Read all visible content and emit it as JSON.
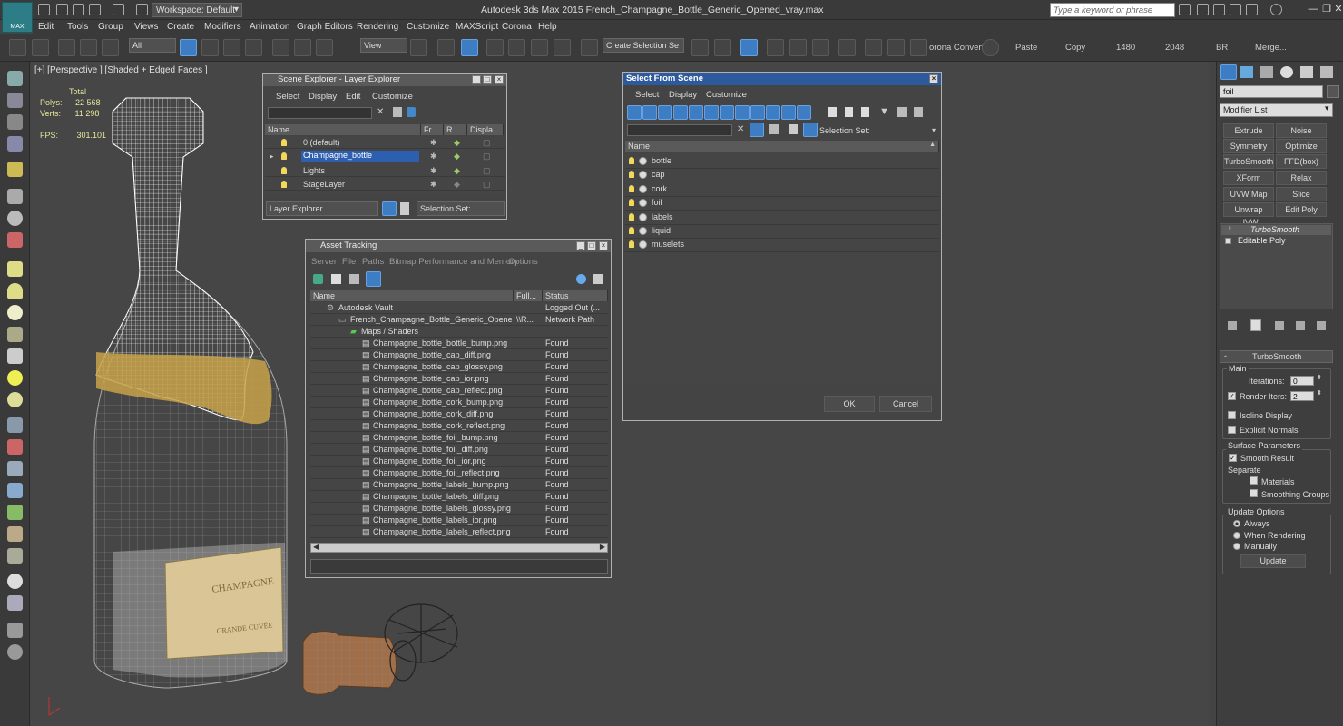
{
  "app": {
    "title": "Autodesk 3ds Max  2015     French_Champagne_Bottle_Generic_Opened_vray.max",
    "logo_label": "MAX",
    "workspace": "Workspace: Default",
    "search_placeholder": "Type a keyword or phrase"
  },
  "menus": [
    "Edit",
    "Tools",
    "Group",
    "Views",
    "Create",
    "Modifiers",
    "Animation",
    "Graph Editors",
    "Rendering",
    "Customize",
    "MAXScript",
    "Corona",
    "Help"
  ],
  "toolbar": {
    "filter": "All",
    "ref_coord": "View",
    "selection_set": "Create Selection Se",
    "corona_convert": "orona Convert",
    "paste": "Paste",
    "copy": "Copy",
    "res1": "1480",
    "res2": "2048",
    "br": "BR",
    "merge": "Merge..."
  },
  "viewport": {
    "label": "[+] [Perspective ] [Shaded + Edged Faces ]",
    "stats_total": "Total",
    "polys_label": "Polys:",
    "polys_value": "22 568",
    "verts_label": "Verts:",
    "verts_value": "11 298",
    "fps_label": "FPS:",
    "fps_value": "301.101"
  },
  "layer_explorer": {
    "title": "Scene Explorer - Layer Explorer",
    "menus": [
      "Select",
      "Display",
      "Edit",
      "Customize"
    ],
    "columns": [
      "Name",
      "Fr...",
      "R...",
      "Displa..."
    ],
    "rows": [
      {
        "name": "0 (default)"
      },
      {
        "name": "Champagne_bottle"
      },
      {
        "name": "Lights"
      },
      {
        "name": "StageLayer"
      }
    ],
    "footer_dropdown": "Layer Explorer",
    "selection_set": "Selection Set:"
  },
  "asset_tracking": {
    "title": "Asset Tracking",
    "menus": [
      "Server",
      "File",
      "Paths",
      "Bitmap Performance and Memory",
      "Options"
    ],
    "columns": [
      "Name",
      "Full...",
      "Status"
    ],
    "vault": {
      "name": "Autodesk Vault",
      "status": "Logged Out (..."
    },
    "file": {
      "name": "French_Champagne_Bottle_Generic_Opened...",
      "full": "\\\\R...",
      "status": "Network Path"
    },
    "maps": "Maps / Shaders",
    "items": [
      {
        "name": "Champagne_bottle_bottle_bump.png",
        "status": "Found"
      },
      {
        "name": "Champagne_bottle_cap_diff.png",
        "status": "Found"
      },
      {
        "name": "Champagne_bottle_cap_glossy.png",
        "status": "Found"
      },
      {
        "name": "Champagne_bottle_cap_ior.png",
        "status": "Found"
      },
      {
        "name": "Champagne_bottle_cap_reflect.png",
        "status": "Found"
      },
      {
        "name": "Champagne_bottle_cork_bump.png",
        "status": "Found"
      },
      {
        "name": "Champagne_bottle_cork_diff.png",
        "status": "Found"
      },
      {
        "name": "Champagne_bottle_cork_reflect.png",
        "status": "Found"
      },
      {
        "name": "Champagne_bottle_foil_bump.png",
        "status": "Found"
      },
      {
        "name": "Champagne_bottle_foil_diff.png",
        "status": "Found"
      },
      {
        "name": "Champagne_bottle_foil_ior.png",
        "status": "Found"
      },
      {
        "name": "Champagne_bottle_foil_reflect.png",
        "status": "Found"
      },
      {
        "name": "Champagne_bottle_labels_bump.png",
        "status": "Found"
      },
      {
        "name": "Champagne_bottle_labels_diff.png",
        "status": "Found"
      },
      {
        "name": "Champagne_bottle_labels_glossy.png",
        "status": "Found"
      },
      {
        "name": "Champagne_bottle_labels_ior.png",
        "status": "Found"
      },
      {
        "name": "Champagne_bottle_labels_reflect.png",
        "status": "Found"
      }
    ]
  },
  "select_from_scene": {
    "title": "Select From Scene",
    "menus": [
      "Select",
      "Display",
      "Customize"
    ],
    "selection_set": "Selection Set:",
    "column": "Name",
    "objects": [
      "bottle",
      "cap",
      "cork",
      "foil",
      "labels",
      "liquid",
      "muselets"
    ],
    "ok": "OK",
    "cancel": "Cancel"
  },
  "command_panel": {
    "name_field": "foil",
    "modifier_list": "Modifier List",
    "buttons": [
      [
        "Extrude",
        "Noise"
      ],
      [
        "Symmetry",
        "Optimize"
      ],
      [
        "TurboSmooth",
        "FFD(box)"
      ],
      [
        "XForm",
        "Relax"
      ],
      [
        "UVW Map",
        "Slice"
      ],
      [
        "Unwrap UVW",
        "Edit Poly"
      ]
    ],
    "stack": [
      "TurboSmooth",
      "Editable Poly"
    ],
    "rollout_title": "TurboSmooth",
    "main_label": "Main",
    "iterations_label": "Iterations:",
    "iterations_value": "0",
    "render_iters_label": "Render Iters:",
    "render_iters_value": "2",
    "isoline": "Isoline Display",
    "explicit": "Explicit Normals",
    "surface_label": "Surface Parameters",
    "smooth_result": "Smooth Result",
    "separate_label": "Separate",
    "materials": "Materials",
    "smoothing_groups": "Smoothing Groups",
    "update_options": "Update Options",
    "always": "Always",
    "when_rendering": "When Rendering",
    "manually": "Manually",
    "update_button": "Update"
  },
  "scene_labels": {
    "label_text1": "CHAMPAGNE",
    "label_text2": "GRANDE CUVÉE"
  },
  "colors": {
    "accent": "#3c7dc4",
    "foil_gold": "#c7a24a",
    "wire": "#ffffff"
  }
}
